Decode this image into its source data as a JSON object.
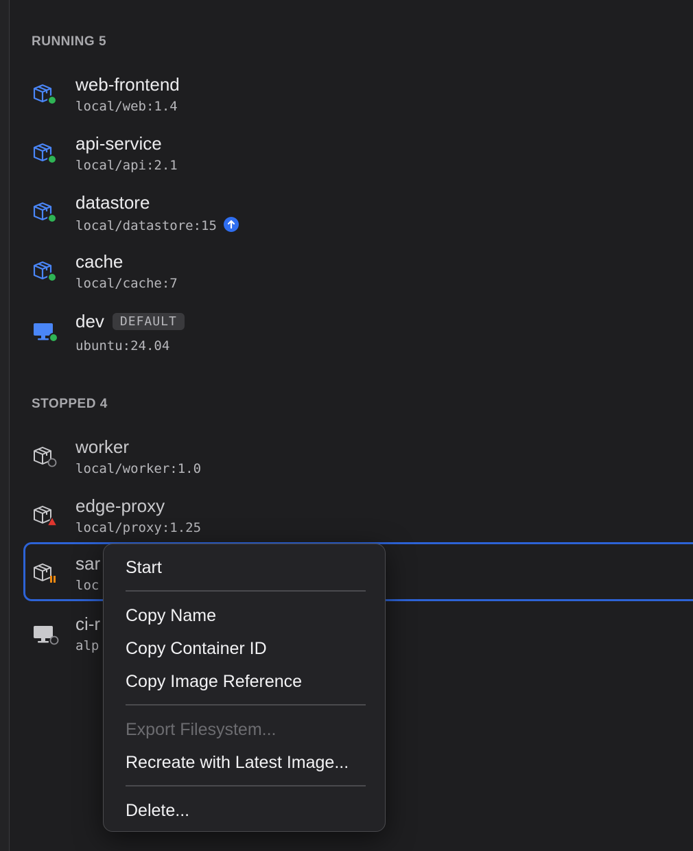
{
  "sections": {
    "running_header": "RUNNING 5",
    "stopped_header": "STOPPED 4"
  },
  "running": [
    {
      "name": "web-frontend",
      "image": "local/web:1.4",
      "kind": "container-icon",
      "status": "running"
    },
    {
      "name": "api-service",
      "image": "local/api:2.1",
      "kind": "container-icon",
      "status": "running"
    },
    {
      "name": "datastore",
      "image": "local/datastore:15",
      "kind": "container-icon",
      "status": "running",
      "update_available": true
    },
    {
      "name": "cache",
      "image": "local/cache:7",
      "kind": "container-icon",
      "status": "running"
    },
    {
      "name": "dev",
      "image": "ubuntu:24.04",
      "kind": "machine-icon",
      "status": "running",
      "badge": "DEFAULT"
    }
  ],
  "stopped": [
    {
      "name": "worker",
      "image": "local/worker:1.0",
      "kind": "container-icon",
      "status": "stopped"
    },
    {
      "name": "edge-proxy",
      "image": "local/proxy:1.25",
      "kind": "container-icon",
      "status": "error"
    },
    {
      "name": "sar",
      "image": "loc",
      "kind": "container-icon",
      "status": "paused",
      "selected": true
    },
    {
      "name": "ci-r",
      "image": "alp",
      "kind": "machine-icon",
      "status": "stopped"
    }
  ],
  "context_menu": {
    "items": [
      {
        "label": "Start",
        "enabled": true
      },
      {
        "label": "Copy Name",
        "enabled": true
      },
      {
        "label": "Copy Container ID",
        "enabled": true
      },
      {
        "label": "Copy Image Reference",
        "enabled": true
      },
      {
        "label": "Export Filesystem...",
        "enabled": false
      },
      {
        "label": "Recreate with Latest Image...",
        "enabled": true
      },
      {
        "label": "Delete...",
        "enabled": true
      }
    ]
  },
  "colors": {
    "accent": "#2d63d6",
    "running": "#2fb455",
    "error": "#e0362f",
    "paused": "#f08a12",
    "container_running": "#4a86f7",
    "container_stopped": "#c9c9cc"
  }
}
